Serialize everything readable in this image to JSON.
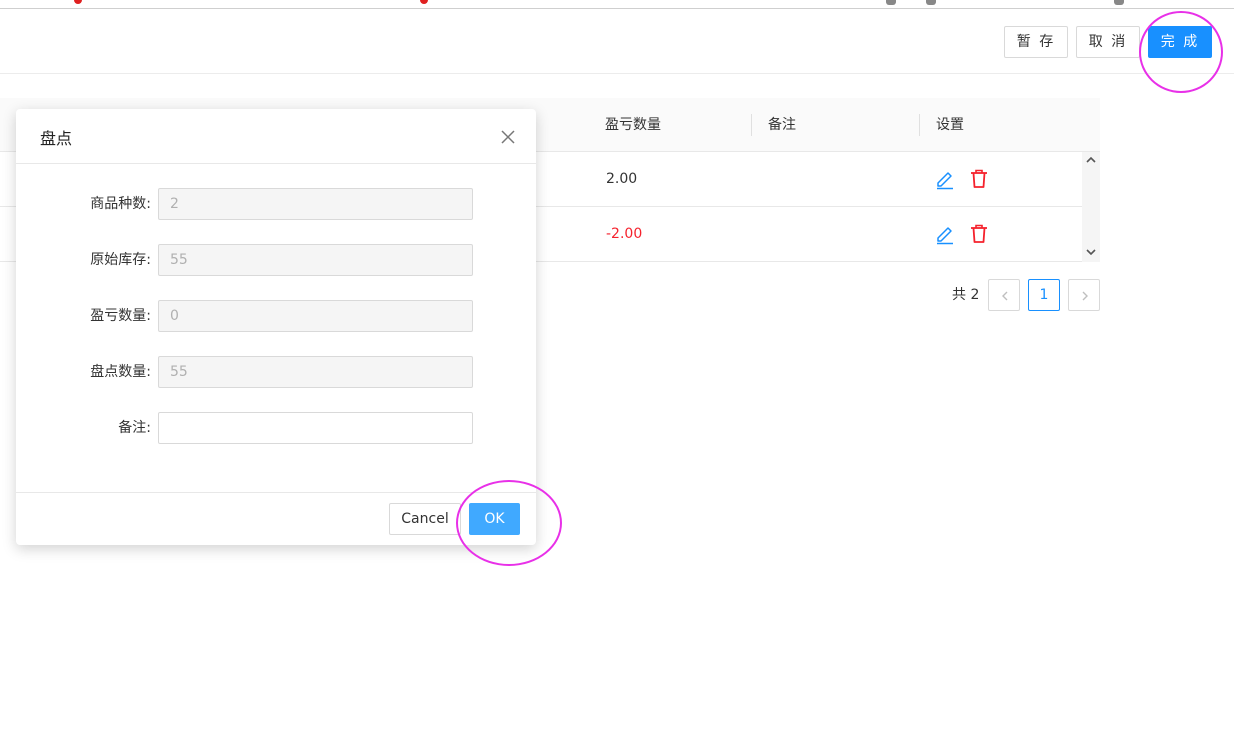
{
  "toolbar": {
    "save_label": "暂 存",
    "cancel_label": "取 消",
    "finish_label": "完 成"
  },
  "table": {
    "columns": [
      "盈亏数量",
      "备注",
      "设置"
    ],
    "rows": [
      {
        "profit_loss": "2.00",
        "note": ""
      },
      {
        "profit_loss": "-2.00",
        "note": ""
      }
    ]
  },
  "pagination": {
    "total": "共 2",
    "current_page": "1"
  },
  "modal": {
    "title": "盘点",
    "fields": [
      {
        "label": "商品种数:",
        "value": "2"
      },
      {
        "label": "原始库存:",
        "value": "55"
      },
      {
        "label": "盈亏数量:",
        "value": "0"
      },
      {
        "label": "盘点数量:",
        "value": "55"
      },
      {
        "label": "备注:",
        "value": ""
      }
    ],
    "cancel_label": "Cancel",
    "ok_label": "OK"
  },
  "colors": {
    "primary": "#1890ff",
    "danger": "#f5222d",
    "annotation_circle": "#e830e8"
  },
  "icons": {
    "edit": "edit-icon",
    "delete": "trash-icon",
    "close": "close-icon",
    "prev": "chevron-left-icon",
    "next": "chevron-right-icon"
  }
}
